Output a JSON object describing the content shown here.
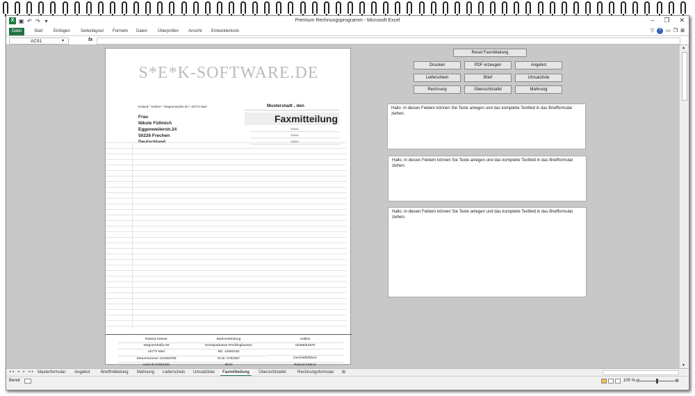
{
  "window": {
    "title": "Premium Rechnungsprogramm - Microsoft Excel",
    "controls": [
      "–",
      "❐",
      "✕"
    ]
  },
  "ribbon": {
    "tabs": [
      "Datei",
      "Start",
      "Einfügen",
      "Seitenlayout",
      "Formeln",
      "Daten",
      "Überprüfen",
      "Ansicht",
      "Entwicklertools"
    ]
  },
  "formula_bar": {
    "name_box": "AC91",
    "fx": "fx",
    "value": ""
  },
  "letter": {
    "brand": "S*E*K-SOFTWARE.DE",
    "sender_line": "Roland * Kettner * Wagnerstraße 50 * 45772 Marl",
    "place_date": "Musterstadt ,    den",
    "recipient": [
      "Frau",
      "Nikole Füllmich",
      "Eggenweilerstr.24",
      "50226 Frechen",
      "Deutschland"
    ],
    "title": "Faxmitteilung",
    "placeholders": [
      "xxxxx",
      "xxxxx",
      "xxxxx"
    ],
    "footer": [
      [
        "Roland Kettner",
        "Wagnerstraße 50",
        "45772 Marl",
        "Steuernummer 123456789",
        "UaSt ID 87654321"
      ],
      [
        "Bankverbindung",
        "Kreissparkasse Recklinghausen",
        "Blz. 42650150",
        "Kt.Nr. 5752357",
        "IBAN"
      ],
      [
        "Hotline",
        "02365/84378",
        "",
        "Geschäftsführer",
        "Roland Kettner"
      ]
    ]
  },
  "buttons": {
    "reset": "Reset Faxmitteilung",
    "drucken": "Drucken",
    "pdf": "PDF erzeugen",
    "angebot": "Angebot",
    "lieferschein": "Lieferschein",
    "brief": "Brief",
    "umsatzliste": "Umsatzliste",
    "rechnung": "Rechnung",
    "uebersichtstafel": "Übersichtstafel",
    "mahnung": "Mahnung"
  },
  "text_boxes": [
    "Hallo. In diesen Feldern können Sie Texte anlegen und das komplette Textfeld in das Briefformular ziehen.",
    "Hallo. In diesen Feldern können Sie Texte anlegen und das komplette Textfeld in das Briefformular ziehen.",
    "Hallo. In diesen Feldern können Sie Texte anlegen und das komplette Textfeld in das Briefformular ziehen."
  ],
  "sheet_tabs": [
    "Masterformular",
    "Angebot",
    "Brieffmitteilung",
    "Mahnung",
    "Lieferschein",
    "Umsatzliste",
    "Faxmitteilung",
    "Übersichtstafel",
    "Rechnungsformular"
  ],
  "active_sheet": "Faxmitteilung",
  "status": {
    "text": "Bereit",
    "zoom": "100 %"
  },
  "colors": {
    "file_tab": "#217346",
    "sheet_bg": "#c8c8c8"
  }
}
